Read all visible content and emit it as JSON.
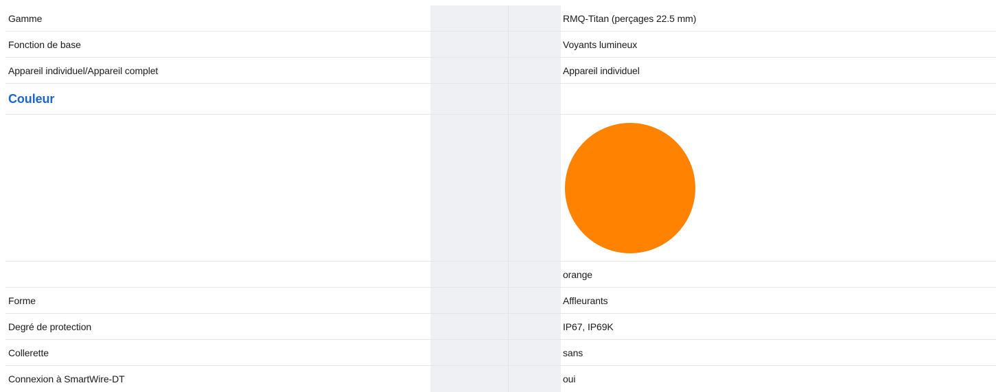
{
  "rows_top": [
    {
      "label": "Gamme",
      "value": "RMQ-Titan (perçages 22.5 mm)"
    },
    {
      "label": "Fonction de base",
      "value": "Voyants lumineux"
    },
    {
      "label": "Appareil individuel/Appareil complet",
      "value": "Appareil individuel"
    }
  ],
  "section": {
    "title": "Couleur",
    "color_value": "orange",
    "swatch_color": "#ff8300"
  },
  "rows_bottom": [
    {
      "label": "Forme",
      "value": "Affleurants"
    },
    {
      "label": "Degré de protection",
      "value": "IP67, IP69K"
    },
    {
      "label": "Collerette",
      "value": "sans"
    },
    {
      "label": "Connexion à SmartWire-DT",
      "value": "oui"
    }
  ]
}
